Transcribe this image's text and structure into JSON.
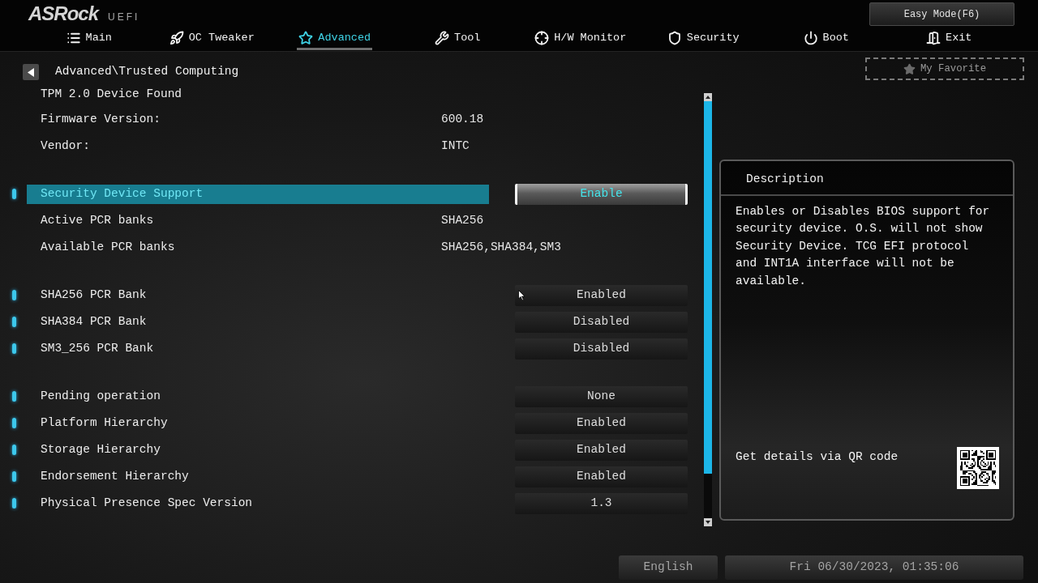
{
  "header": {
    "logo": "ASRock",
    "logo_suffix": "UEFI",
    "easy_mode_button": "Easy Mode(F6)"
  },
  "tabs": [
    {
      "label": "Main",
      "selected": false
    },
    {
      "label": "OC Tweaker",
      "selected": false
    },
    {
      "label": "Advanced",
      "selected": true
    },
    {
      "label": "Tool",
      "selected": false
    },
    {
      "label": "H/W Monitor",
      "selected": false
    },
    {
      "label": "Security",
      "selected": false
    },
    {
      "label": "Boot",
      "selected": false
    },
    {
      "label": "Exit",
      "selected": false
    }
  ],
  "favorite_button": "My Favorite",
  "breadcrumb": "Advanced\\Trusted Computing",
  "groups": [
    {
      "items": [
        {
          "kind": "heading",
          "label": "TPM 2.0 Device Found",
          "selected": false
        },
        {
          "kind": "info",
          "label": "Firmware Version:",
          "value": "600.18",
          "selected": false
        },
        {
          "kind": "info",
          "label": "Vendor:",
          "value": "INTC",
          "selected": false
        }
      ]
    },
    {
      "items": [
        {
          "kind": "option",
          "label": "Security Device Support",
          "value": "Enable",
          "selected": true
        },
        {
          "kind": "info",
          "label": "Active PCR banks",
          "value": "SHA256",
          "selected": false
        },
        {
          "kind": "info",
          "label": "Available PCR banks",
          "value": "SHA256,SHA384,SM3",
          "selected": false
        }
      ]
    },
    {
      "items": [
        {
          "kind": "option",
          "label": "SHA256 PCR Bank",
          "value": "Enabled",
          "selected": false
        },
        {
          "kind": "option",
          "label": "SHA384 PCR Bank",
          "value": "Disabled",
          "selected": false
        },
        {
          "kind": "option",
          "label": "SM3_256 PCR Bank",
          "value": "Disabled",
          "selected": false
        }
      ]
    },
    {
      "items": [
        {
          "kind": "option",
          "label": "Pending operation",
          "value": "None",
          "selected": false
        },
        {
          "kind": "option",
          "label": "Platform Hierarchy",
          "value": "Enabled",
          "selected": false
        },
        {
          "kind": "option",
          "label": "Storage Hierarchy",
          "value": "Enabled",
          "selected": false
        },
        {
          "kind": "option",
          "label": "Endorsement Hierarchy",
          "value": "Enabled",
          "selected": false
        },
        {
          "kind": "option",
          "label": "Physical Presence Spec Version",
          "value": "1.3",
          "selected": false
        }
      ]
    }
  ],
  "description": {
    "title": "Description",
    "text": "Enables or Disables BIOS support for security device. O.S. will not show Security Device. TCG EFI protocol and INT1A interface will not be available.",
    "qr_caption": "Get details via QR code"
  },
  "footer": {
    "language": "English",
    "datetime": "Fri 06/30/2023, 01:35:06"
  }
}
